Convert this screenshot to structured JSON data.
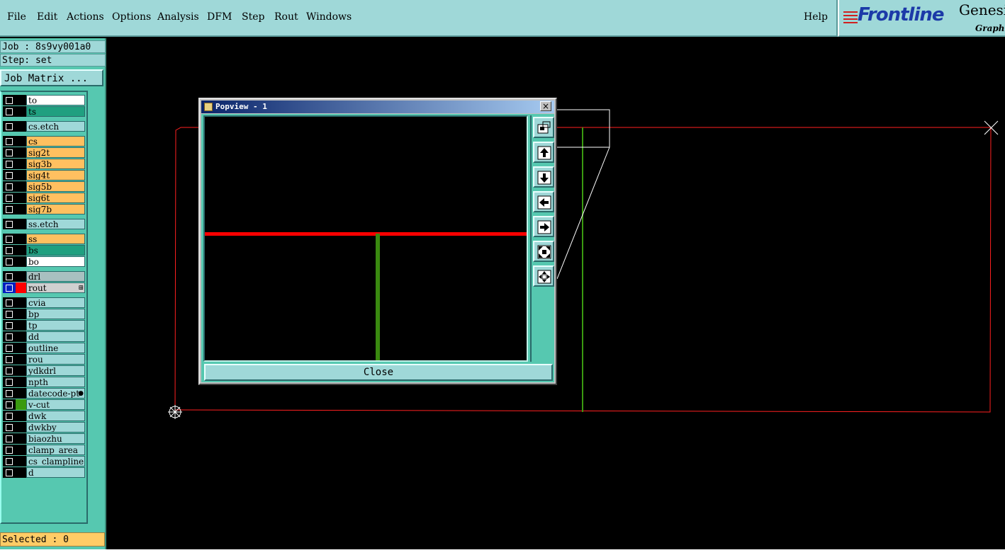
{
  "menu": {
    "items": [
      "File",
      "Edit",
      "Actions",
      "Options",
      "Analysis",
      "DFM",
      "Step",
      "Rout",
      "Windows"
    ],
    "help": "Help"
  },
  "logo": {
    "brand": "Frontline",
    "product": "Genesi",
    "subtitle": "Graphi"
  },
  "job": {
    "job_line": "Job : 8s9vy001a0",
    "step_line": "Step: set",
    "matrix_button": "Job Matrix ..."
  },
  "layers": [
    {
      "name": "to",
      "color": "#ffffff",
      "swatch": "#000000"
    },
    {
      "name": "ts",
      "color": "#20a080",
      "swatch": "#000000"
    },
    {
      "name": "cs.etch",
      "color": "#9fd8d8",
      "swatch": "#000000"
    },
    {
      "name": "cs",
      "color": "#ffc060",
      "swatch": "#000000"
    },
    {
      "name": "sig2t",
      "color": "#ffc060",
      "swatch": "#000000"
    },
    {
      "name": "sig3b",
      "color": "#ffc060",
      "swatch": "#000000"
    },
    {
      "name": "sig4t",
      "color": "#ffc060",
      "swatch": "#000000"
    },
    {
      "name": "sig5b",
      "color": "#ffc060",
      "swatch": "#000000"
    },
    {
      "name": "sig6t",
      "color": "#ffc060",
      "swatch": "#000000"
    },
    {
      "name": "sig7b",
      "color": "#ffc060",
      "swatch": "#000000"
    },
    {
      "name": "ss.etch",
      "color": "#9fd8d8",
      "swatch": "#000000"
    },
    {
      "name": "ss",
      "color": "#ffc060",
      "swatch": "#000000"
    },
    {
      "name": "bs",
      "color": "#20a080",
      "swatch": "#000000"
    },
    {
      "name": "bo",
      "color": "#ffffff",
      "swatch": "#000000"
    },
    {
      "name": "drl",
      "color": "#a8c0c0",
      "swatch": "#000000"
    },
    {
      "name": "rout",
      "color": "#d0d0d0",
      "swatch": "#ff0000",
      "active": true,
      "marker": "⊞"
    },
    {
      "name": "cvia",
      "color": "#9fd8d8",
      "swatch": "#000000"
    },
    {
      "name": "bp",
      "color": "#9fd8d8",
      "swatch": "#000000"
    },
    {
      "name": "tp",
      "color": "#9fd8d8",
      "swatch": "#000000"
    },
    {
      "name": "dd",
      "color": "#9fd8d8",
      "swatch": "#000000"
    },
    {
      "name": "outline",
      "color": "#9fd8d8",
      "swatch": "#000000"
    },
    {
      "name": "rou",
      "color": "#9fd8d8",
      "swatch": "#000000"
    },
    {
      "name": "ydkdrl",
      "color": "#9fd8d8",
      "swatch": "#000000"
    },
    {
      "name": "npth",
      "color": "#9fd8d8",
      "swatch": "#000000"
    },
    {
      "name": "datecode-pt",
      "color": "#9fd8d8",
      "swatch": "#000000",
      "marker": "●"
    },
    {
      "name": "v-cut",
      "color": "#9fd8d8",
      "swatch": "#3a9a10"
    },
    {
      "name": "dwk",
      "color": "#9fd8d8",
      "swatch": "#000000"
    },
    {
      "name": "dwkby",
      "color": "#9fd8d8",
      "swatch": "#000000"
    },
    {
      "name": "biaozhu",
      "color": "#9fd8d8",
      "swatch": "#000000"
    },
    {
      "name": "clamp_area",
      "color": "#9fd8d8",
      "swatch": "#000000"
    },
    {
      "name": "cs_clampline",
      "color": "#9fd8d8",
      "swatch": "#000000"
    },
    {
      "name": "d",
      "color": "#9fd8d8",
      "swatch": "#000000"
    }
  ],
  "status": {
    "selected": "Selected : 0"
  },
  "popview": {
    "title": "Popview - 1",
    "close_label": "Close",
    "close_x": "×",
    "tools": [
      "zoom-window-icon",
      "pan-up-icon",
      "pan-down-icon",
      "pan-left-icon",
      "pan-right-icon",
      "zoom-fit-icon",
      "zoom-home-icon"
    ]
  },
  "colors": {
    "rout_line": "#ff0000",
    "vcut_line": "#3a9a10",
    "panel_bg": "#56c8b0",
    "menu_bg": "#9fd8d8"
  }
}
